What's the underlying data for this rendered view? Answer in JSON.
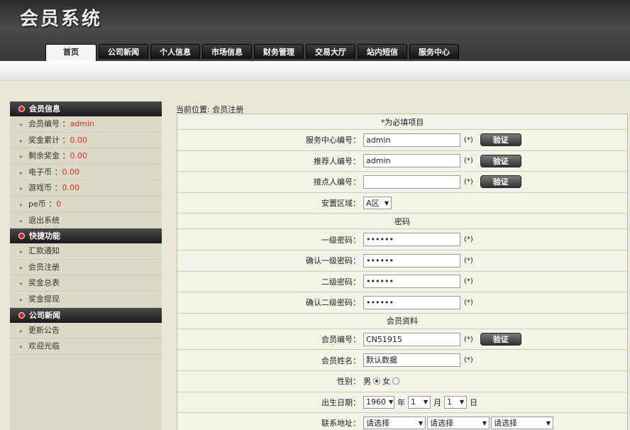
{
  "app": {
    "title": "会员系统"
  },
  "nav": [
    "首页",
    "公司新闻",
    "个人信息",
    "市场信息",
    "财务管理",
    "交易大厅",
    "站内短信",
    "服务中心"
  ],
  "sidebar": {
    "member_info": {
      "title": "会员信息",
      "items": [
        {
          "label": "会员编号 ：",
          "value": "admin"
        },
        {
          "label": "奖金累计 ：",
          "value": "0.00"
        },
        {
          "label": "剩余奖金 ：",
          "value": "0.00"
        },
        {
          "label": "电子币 ：",
          "value": "0.00"
        },
        {
          "label": "游戏币 ：",
          "value": "0.00"
        },
        {
          "label": "pe币 ：",
          "value": "0"
        },
        {
          "label": "退出系统",
          "value": ""
        }
      ]
    },
    "quick": {
      "title": "快捷功能",
      "items": [
        "汇款通知",
        "会员注册",
        "奖金总表",
        "奖金提现"
      ]
    },
    "news": {
      "title": "公司新闻",
      "items": [
        "更新公告",
        "欢迎光临"
      ]
    }
  },
  "breadcrumb": "当前位置: 会员注册",
  "form": {
    "section_required": "*为必填项目",
    "service_center_label": "服务中心编号",
    "service_center_value": "admin",
    "referrer_label": "推荐人编号",
    "referrer_value": "admin",
    "contact_label": "接点人编号",
    "contact_value": "",
    "area_label": "安置区域",
    "area_value": "A区",
    "section_password": "密码",
    "pwd1_label": "一级密码",
    "pwd1_value": "••••••",
    "pwd1_confirm_label": "确认一级密码",
    "pwd1_confirm_value": "••••••",
    "pwd2_label": "二级密码",
    "pwd2_value": "••••••",
    "pwd2_confirm_label": "确认二级密码",
    "pwd2_confirm_value": "••••••",
    "section_profile": "会员资料",
    "member_no_label": "会员编号",
    "member_no_value": "CN51915",
    "member_name_label": "会员姓名",
    "member_name_value": "默认数据",
    "gender_label": "性别",
    "gender_male": "男",
    "gender_female": "女",
    "birth_label": "出生日期",
    "birth_year": "1960",
    "birth_year_unit": "年",
    "birth_month": "1",
    "birth_month_unit": "月",
    "birth_day": "1",
    "birth_day_unit": "日",
    "address_label": "联系地址",
    "address_province": "请选择",
    "address_city": "请选择",
    "address_district": "请选择",
    "required_mark": "(*)",
    "verify_label": "验证",
    "colon": "："
  }
}
